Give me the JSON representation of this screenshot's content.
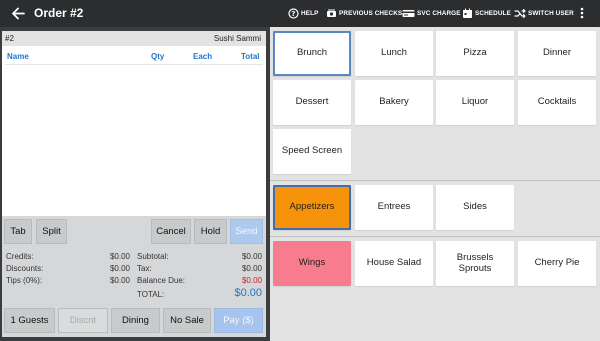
{
  "topbar": {
    "title": "Order #2",
    "actions": [
      {
        "label": "HELP",
        "icon": "help-icon"
      },
      {
        "label": "PREVIOUS CHECKS",
        "icon": "previous-checks-icon"
      },
      {
        "label": "SVC CHARGE",
        "icon": "service-charge-icon"
      },
      {
        "label": "SCHEDULE",
        "icon": "schedule-icon"
      },
      {
        "label": "SWITCH USER",
        "icon": "switch-user-icon"
      }
    ],
    "more_icon": "more-vert-icon"
  },
  "order": {
    "number": "#2",
    "restaurant": "Sushi Sammi",
    "columns": {
      "name": "Name",
      "qty": "Qty",
      "each": "Each",
      "total": "Total"
    },
    "buttons": {
      "tab": "Tab",
      "split": "Split",
      "cancel": "Cancel",
      "hold": "Hold",
      "send": "Send",
      "guests": "1 Guests",
      "discount": "Discnt",
      "dining": "Dining",
      "no_sale": "No Sale",
      "pay": "Pay ($)"
    },
    "totals": {
      "credits_label": "Credits:",
      "credits": "$0.00",
      "discounts_label": "Discounts:",
      "discounts": "$0.00",
      "tips_label": "Tips (0%):",
      "tips": "$0.00",
      "subtotal_label": "Subtotal:",
      "subtotal": "$0.00",
      "tax_label": "Tax:",
      "tax": "$0.00",
      "balance_label": "Balance Due:",
      "balance": "$0.00",
      "total_label": "TOTAL:",
      "total": "$0.00"
    },
    "colors": {
      "accent_blue": "#1f77c8",
      "balance_red": "#c0262d"
    }
  },
  "menus": {
    "categories": [
      "Brunch",
      "Lunch",
      "Pizza",
      "Dinner",
      "Dessert",
      "Bakery",
      "Liquor",
      "Cocktails",
      "Speed Screen"
    ],
    "selected_category": "Brunch",
    "subcategories": [
      "Appetizers",
      "Entrees",
      "Sides"
    ],
    "selected_subcategory": "Appetizers",
    "items": [
      "Wings",
      "House Salad",
      "Brussels Sprouts",
      "Cherry Pie"
    ],
    "colors": {
      "appetizers": "#f6930a",
      "wings": "#f77d8e"
    }
  }
}
